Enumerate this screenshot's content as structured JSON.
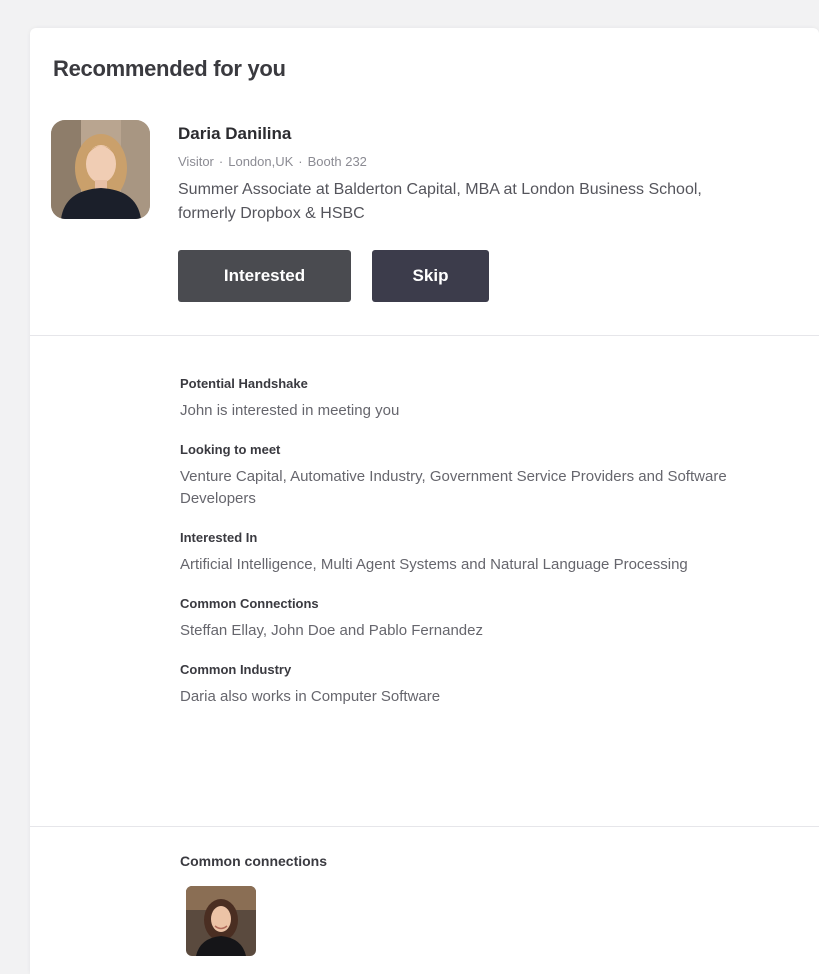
{
  "section": {
    "title": "Recommended for you"
  },
  "profile": {
    "name": "Daria Danilina",
    "role": "Visitor",
    "location": "London,UK",
    "booth": "Booth 232",
    "headline": "Summer Associate at Balderton Capital, MBA at London Business School, formerly Dropbox & HSBC"
  },
  "actions": {
    "interested_label": "Interested",
    "skip_label": "Skip"
  },
  "details": [
    {
      "label": "Potential Handshake",
      "value": "John is interested in meeting you"
    },
    {
      "label": "Looking to meet",
      "value": "Venture Capital, Automative Industry, Government Service Providers and Software Developers"
    },
    {
      "label": "Interested In",
      "value": "Artificial Intelligence, Multi Agent Systems and Natural Language Processing"
    },
    {
      "label": "Common Connections",
      "value": "Steffan Ellay, John Doe and Pablo Fernandez"
    },
    {
      "label": "Common Industry",
      "value": "Daria also works in Computer Software"
    }
  ],
  "common_connections": {
    "title": "Common connections"
  },
  "colors": {
    "interested_button": "#4a4b50",
    "skip_button": "#3c3c4b"
  }
}
